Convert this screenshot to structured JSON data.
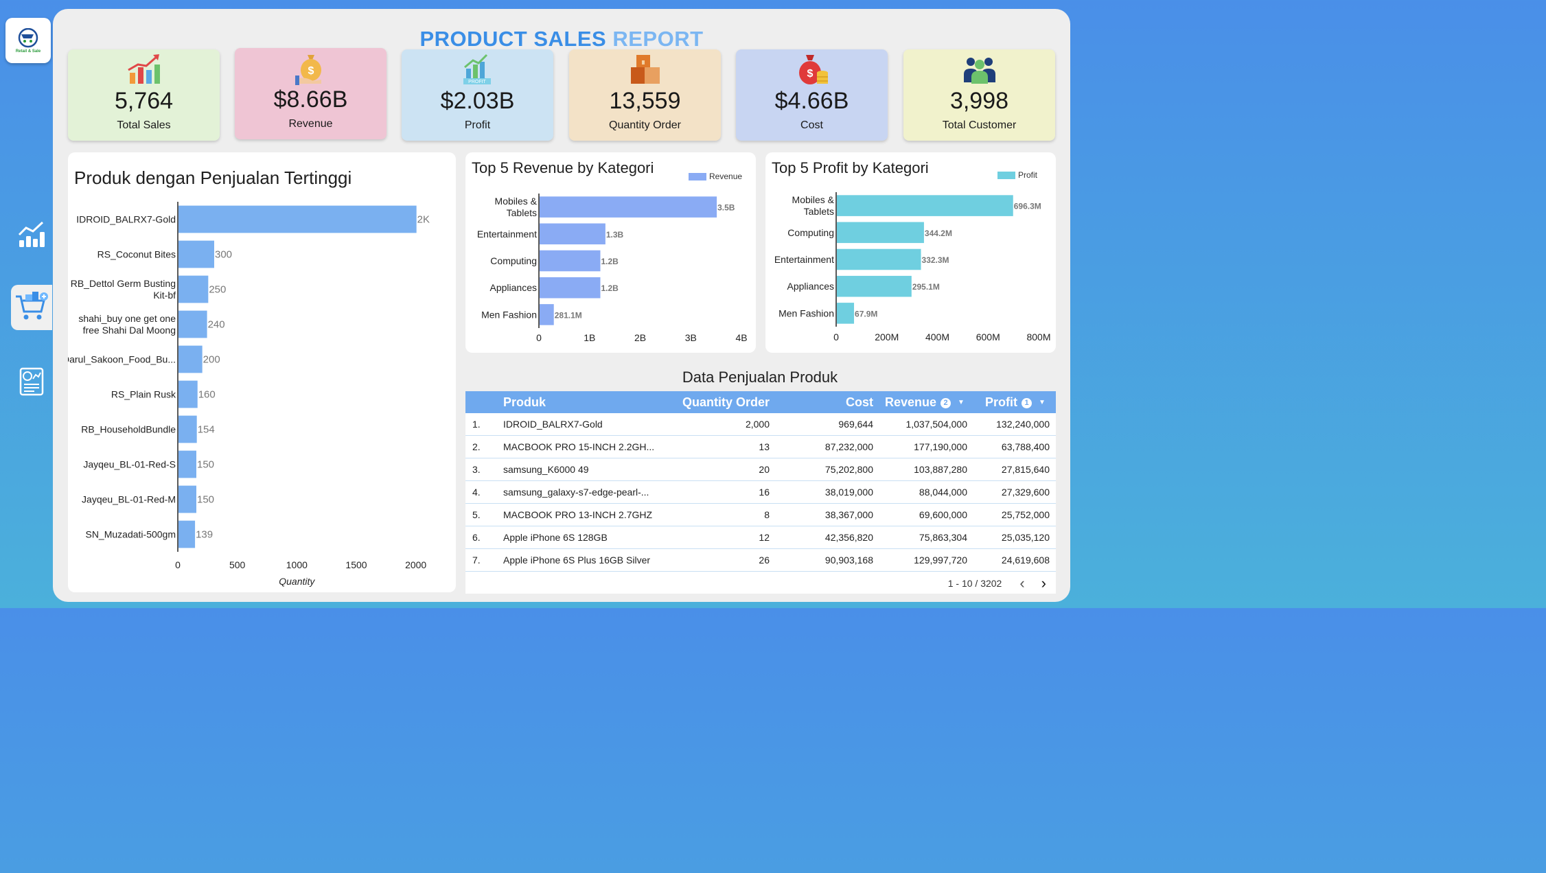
{
  "app": {
    "logo_text": "Retail & Sale",
    "title_part1": "PRODUCT SALES",
    "title_part2": "REPORT"
  },
  "sidebar": {
    "items": [
      {
        "icon": "bar-chart-icon",
        "active": false
      },
      {
        "icon": "shopping-cart-icon",
        "active": true
      },
      {
        "icon": "report-icon",
        "active": false
      }
    ]
  },
  "kpis": [
    {
      "value": "5,764",
      "label": "Total Sales",
      "bg": "#e3f2d7",
      "icon": "growth-chart-icon"
    },
    {
      "value": "$8.66B",
      "label": "Revenue",
      "bg": "#efc5d4",
      "icon": "money-bag-icon"
    },
    {
      "value": "$2.03B",
      "label": "Profit",
      "bg": "#cce3f3",
      "icon": "profit-chart-icon"
    },
    {
      "value": "13,559",
      "label": "Quantity Order",
      "bg": "#f3e2c7",
      "icon": "boxes-icon"
    },
    {
      "value": "$4.66B",
      "label": "Cost",
      "bg": "#c8d5f2",
      "icon": "cost-bag-icon"
    },
    {
      "value": "3,998",
      "label": "Total Customer",
      "bg": "#f1f2cc",
      "icon": "customers-icon"
    }
  ],
  "chart_data": [
    {
      "type": "bar",
      "orientation": "horizontal",
      "title": "Produk dengan Penjualan Tertinggi",
      "xlabel": "Quantity",
      "categories": [
        "IDROID_BALRX7-Gold",
        "RS_Coconut Bites",
        "RB_Dettol Germ Busting Kit-bf",
        "shahi_buy one get one free Shahi Dal Moong",
        "Darul_Sakoon_Food_Bu...",
        "RS_Plain Rusk",
        "RB_HouseholdBundle",
        "Jayqeu_BL-01-Red-S",
        "Jayqeu_BL-01-Red-M",
        "SN_Muzadati-500gm"
      ],
      "category_lines": [
        [
          "IDROID_BALRX7-Gold"
        ],
        [
          "RS_Coconut Bites"
        ],
        [
          "RB_Dettol Germ Busting",
          "Kit-bf"
        ],
        [
          "shahi_buy one get one",
          "free Shahi Dal Moong"
        ],
        [
          "Darul_Sakoon_Food_Bu..."
        ],
        [
          "RS_Plain Rusk"
        ],
        [
          "RB_HouseholdBundle"
        ],
        [
          "Jayqeu_BL-01-Red-S"
        ],
        [
          "Jayqeu_BL-01-Red-M"
        ],
        [
          "SN_Muzadati-500gm"
        ]
      ],
      "values": [
        2000,
        300,
        250,
        240,
        200,
        160,
        154,
        150,
        150,
        139
      ],
      "value_labels": [
        "2K",
        "300",
        "250",
        "240",
        "200",
        "160",
        "154",
        "150",
        "150",
        "139"
      ],
      "xlim": [
        0,
        2250
      ],
      "xticks": [
        0,
        500,
        1000,
        1500,
        2000
      ],
      "color": "#7ab0f0"
    },
    {
      "type": "bar",
      "orientation": "horizontal",
      "title": "Top 5 Revenue by Kategori",
      "legend": "Revenue",
      "legend_position": "top-right",
      "categories": [
        "Mobiles & Tablets",
        "Entertainment",
        "Computing",
        "Appliances",
        "Men Fashion"
      ],
      "category_lines": [
        [
          "Mobiles &",
          "Tablets"
        ],
        [
          "Entertainment"
        ],
        [
          "Computing"
        ],
        [
          "Appliances"
        ],
        [
          "Men Fashion"
        ]
      ],
      "values": [
        3500000000,
        1300000000,
        1200000000,
        1200000000,
        281100000
      ],
      "value_labels": [
        "3.5B",
        "1.3B",
        "1.2B",
        "1.2B",
        "281.1M"
      ],
      "xlim": [
        0,
        4000000000
      ],
      "xticks": [
        0,
        1000000000,
        2000000000,
        3000000000,
        4000000000
      ],
      "xtick_labels": [
        "0",
        "1B",
        "2B",
        "3B",
        "4B"
      ],
      "color": "#8aabf4"
    },
    {
      "type": "bar",
      "orientation": "horizontal",
      "title": "Top 5 Profit by Kategori",
      "legend": "Profit",
      "legend_position": "top-right",
      "categories": [
        "Mobiles & Tablets",
        "Computing",
        "Entertainment",
        "Appliances",
        "Men Fashion"
      ],
      "category_lines": [
        [
          "Mobiles &",
          "Tablets"
        ],
        [
          "Computing"
        ],
        [
          "Entertainment"
        ],
        [
          "Appliances"
        ],
        [
          "Men Fashion"
        ]
      ],
      "values": [
        696300000,
        344200000,
        332300000,
        295100000,
        67900000
      ],
      "value_labels": [
        "696.3M",
        "344.2M",
        "332.3M",
        "295.1M",
        "67.9M"
      ],
      "xlim": [
        0,
        800000000
      ],
      "xticks": [
        0,
        200000000,
        400000000,
        600000000,
        800000000
      ],
      "xtick_labels": [
        "0",
        "200M",
        "400M",
        "600M",
        "800M"
      ],
      "color": "#6fcfe0"
    }
  ],
  "table": {
    "title": "Data Penjualan Produk",
    "headers": {
      "produk": "Produk",
      "qty": "Quantity Order",
      "cost": "Cost",
      "revenue": "Revenue",
      "profit": "Profit"
    },
    "revenue_sort_badge": "2",
    "profit_sort_badge": "1",
    "rows": [
      {
        "no": "1.",
        "produk": "IDROID_BALRX7-Gold",
        "qty": "2,000",
        "cost": "969,644",
        "revenue": "1,037,504,000",
        "profit": "132,240,000"
      },
      {
        "no": "2.",
        "produk": "MACBOOK PRO 15-INCH 2.2GH...",
        "qty": "13",
        "cost": "87,232,000",
        "revenue": "177,190,000",
        "profit": "63,788,400"
      },
      {
        "no": "3.",
        "produk": "samsung_K6000 49",
        "qty": "20",
        "cost": "75,202,800",
        "revenue": "103,887,280",
        "profit": "27,815,640"
      },
      {
        "no": "4.",
        "produk": "samsung_galaxy-s7-edge-pearl-...",
        "qty": "16",
        "cost": "38,019,000",
        "revenue": "88,044,000",
        "profit": "27,329,600"
      },
      {
        "no": "5.",
        "produk": "MACBOOK PRO 13-INCH 2.7GHZ",
        "qty": "8",
        "cost": "38,367,000",
        "revenue": "69,600,000",
        "profit": "25,752,000"
      },
      {
        "no": "6.",
        "produk": "Apple iPhone 6S 128GB",
        "qty": "12",
        "cost": "42,356,820",
        "revenue": "75,863,304",
        "profit": "25,035,120"
      },
      {
        "no": "7.",
        "produk": "Apple iPhone 6S Plus 16GB Silver",
        "qty": "26",
        "cost": "90,903,168",
        "revenue": "129,997,720",
        "profit": "24,619,608"
      }
    ],
    "pagination": "1 - 10 / 3202",
    "prev_icon": "‹",
    "next_icon": "›"
  }
}
